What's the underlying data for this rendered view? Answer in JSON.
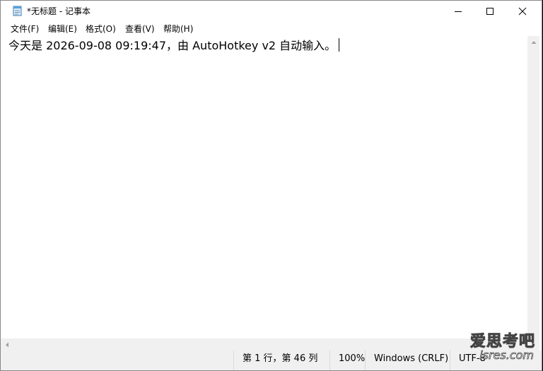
{
  "window": {
    "title": "*无标题 - 记事本",
    "app_icon": "notepad-icon"
  },
  "controls": {
    "minimize": "minimize-icon",
    "maximize": "maximize-icon",
    "close": "close-icon"
  },
  "menu": [
    {
      "label": "文件(F)"
    },
    {
      "label": "编辑(E)"
    },
    {
      "label": "格式(O)"
    },
    {
      "label": "查看(V)"
    },
    {
      "label": "帮助(H)"
    }
  ],
  "editor": {
    "content": "今天是 2026-09-08 09:19:47，由 AutoHotkey v2 自动输入。"
  },
  "status": {
    "position": "第 1 行，第 46 列",
    "zoom": "100%",
    "line_ending": "Windows (CRLF)",
    "encoding": "UTF-8"
  },
  "watermark": {
    "line1": "爱思考吧",
    "line2": "isres.com"
  }
}
